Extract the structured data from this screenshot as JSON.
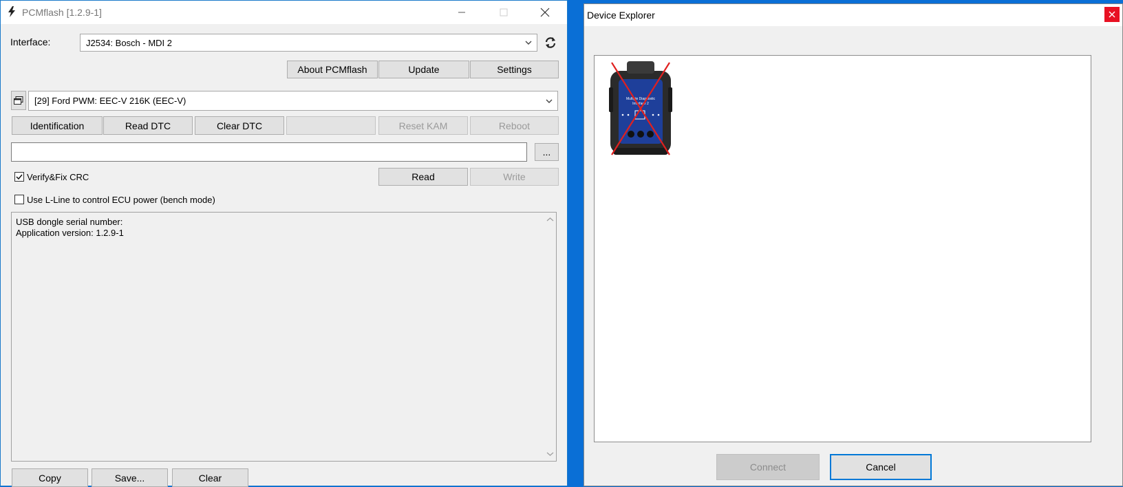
{
  "pcmflash": {
    "window_title": "PCMflash [1.2.9-1]",
    "interface_label": "Interface:",
    "interface_value": "J2534: Bosch - MDI 2",
    "about_button": "About PCMflash",
    "update_button": "Update",
    "settings_button": "Settings",
    "module_value": "[29] Ford PWM: EEC-V 216K (EEC-V)",
    "identification_button": "Identification",
    "read_dtc_button": "Read DTC",
    "clear_dtc_button": "Clear DTC",
    "blank_button": "",
    "reset_kam_button": "Reset KAM",
    "reboot_button": "Reboot",
    "file_path_value": "",
    "browse_button": "...",
    "verify_crc_label": "Verify&Fix CRC",
    "verify_crc_checked": true,
    "lline_label": "Use L-Line to control ECU power (bench mode)",
    "lline_checked": false,
    "read_button": "Read",
    "write_button": "Write",
    "log_lines": [
      "USB dongle serial number:",
      "Application version: 1.2.9-1"
    ],
    "copy_button": "Copy",
    "save_button": "Save...",
    "clear_button": "Clear"
  },
  "device_explorer": {
    "window_title": "Device Explorer",
    "device_icon": "mdi2-device-unavailable-icon",
    "device_image_text": [
      "Multiple Diagnostic",
      "Interface 2"
    ],
    "connect_button": "Connect",
    "cancel_button": "Cancel"
  },
  "colors": {
    "desktop": "#0a6fd6",
    "window_bg": "#f0f0f0",
    "close_red": "#e81123",
    "focus_blue": "#0078d7",
    "device_blue": "#1e3f9a"
  }
}
